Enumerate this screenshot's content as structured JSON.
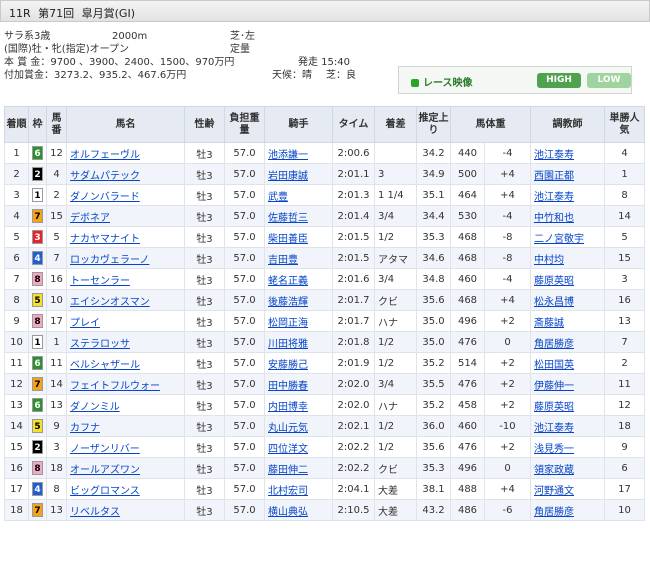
{
  "race": {
    "number": "11R",
    "edition": "第71回",
    "name": "皐月賞(GI)"
  },
  "info": {
    "class": "サラ系3歳",
    "distance": "2000m",
    "track": "芝･左",
    "conditions": "(国際)牡・牝(指定)オープン",
    "weight_rule": "定量",
    "prize": "本 賞 金：9700 、3900、2400、1500、970万円",
    "post_time": "発走 15:40",
    "bonus": "付加賞金：3273.2、935.2、467.6万円",
    "weather": "天候：晴",
    "going": "芝：良"
  },
  "video": {
    "label": "レース映像",
    "high": "HIGH",
    "low": "LOW"
  },
  "headers": [
    "着順",
    "枠",
    "馬番",
    "馬名",
    "性齢",
    "負担重量",
    "騎手",
    "タイム",
    "着差",
    "推定上り",
    "馬体重",
    "調教師",
    "単勝人気"
  ],
  "frame_colors": {
    "1": {
      "bg": "#ffffff",
      "fg": "#000000"
    },
    "2": {
      "bg": "#000000",
      "fg": "#ffffff"
    },
    "3": {
      "bg": "#e8232a",
      "fg": "#ffffff"
    },
    "4": {
      "bg": "#1f5fd0",
      "fg": "#ffffff"
    },
    "5": {
      "bg": "#f5e12b",
      "fg": "#000000"
    },
    "6": {
      "bg": "#2d8f2d",
      "fg": "#ffffff"
    },
    "7": {
      "bg": "#f5a21b",
      "fg": "#000000"
    },
    "8": {
      "bg": "#f4a6c3",
      "fg": "#000000"
    }
  },
  "rows": [
    {
      "rank": "1",
      "frame": "6",
      "num": "12",
      "horse": "オルフェーヴル",
      "sex_age": "牡3",
      "weight": "57.0",
      "jockey": "池添謙一",
      "time": "2:00.6",
      "margin": "",
      "last3f": "34.2",
      "body": "440",
      "diff": "-4",
      "trainer": "池江泰寿",
      "pop": "4"
    },
    {
      "rank": "2",
      "frame": "2",
      "num": "4",
      "horse": "サダムパテック",
      "sex_age": "牡3",
      "weight": "57.0",
      "jockey": "岩田康誠",
      "time": "2:01.1",
      "margin": "3",
      "last3f": "34.9",
      "body": "500",
      "diff": "+4",
      "trainer": "西園正都",
      "pop": "1"
    },
    {
      "rank": "3",
      "frame": "1",
      "num": "2",
      "horse": "ダノンバラード",
      "sex_age": "牡3",
      "weight": "57.0",
      "jockey": "武豊",
      "time": "2:01.3",
      "margin": "1 1/4",
      "last3f": "35.1",
      "body": "464",
      "diff": "+4",
      "trainer": "池江泰寿",
      "pop": "8"
    },
    {
      "rank": "4",
      "frame": "7",
      "num": "15",
      "horse": "デボネア",
      "sex_age": "牡3",
      "weight": "57.0",
      "jockey": "佐藤哲三",
      "time": "2:01.4",
      "margin": "3/4",
      "last3f": "34.4",
      "body": "530",
      "diff": "-4",
      "trainer": "中竹和也",
      "pop": "14"
    },
    {
      "rank": "5",
      "frame": "3",
      "num": "5",
      "horse": "ナカヤマナイト",
      "sex_age": "牡3",
      "weight": "57.0",
      "jockey": "柴田善臣",
      "time": "2:01.5",
      "margin": "1/2",
      "last3f": "35.3",
      "body": "468",
      "diff": "-8",
      "trainer": "二ノ宮敬宇",
      "pop": "5"
    },
    {
      "rank": "6",
      "frame": "4",
      "num": "7",
      "horse": "ロッカヴェラーノ",
      "sex_age": "牡3",
      "weight": "57.0",
      "jockey": "吉田豊",
      "time": "2:01.5",
      "margin": "アタマ",
      "last3f": "34.6",
      "body": "468",
      "diff": "-8",
      "trainer": "中村均",
      "pop": "15"
    },
    {
      "rank": "7",
      "frame": "8",
      "num": "16",
      "horse": "トーセンラー",
      "sex_age": "牡3",
      "weight": "57.0",
      "jockey": "蛯名正義",
      "time": "2:01.6",
      "margin": "3/4",
      "last3f": "34.8",
      "body": "460",
      "diff": "-4",
      "trainer": "藤原英昭",
      "pop": "3"
    },
    {
      "rank": "8",
      "frame": "5",
      "num": "10",
      "horse": "エイシンオスマン",
      "sex_age": "牡3",
      "weight": "57.0",
      "jockey": "後藤浩輝",
      "time": "2:01.7",
      "margin": "クビ",
      "last3f": "35.6",
      "body": "468",
      "diff": "+4",
      "trainer": "松永昌博",
      "pop": "16"
    },
    {
      "rank": "9",
      "frame": "8",
      "num": "17",
      "horse": "プレイ",
      "sex_age": "牡3",
      "weight": "57.0",
      "jockey": "松岡正海",
      "time": "2:01.7",
      "margin": "ハナ",
      "last3f": "35.0",
      "body": "496",
      "diff": "+2",
      "trainer": "斎藤誠",
      "pop": "13"
    },
    {
      "rank": "10",
      "frame": "1",
      "num": "1",
      "horse": "ステラロッサ",
      "sex_age": "牡3",
      "weight": "57.0",
      "jockey": "川田将雅",
      "time": "2:01.8",
      "margin": "1/2",
      "last3f": "35.0",
      "body": "476",
      "diff": "0",
      "trainer": "角居勝彦",
      "pop": "7"
    },
    {
      "rank": "11",
      "frame": "6",
      "num": "11",
      "horse": "ベルシャザール",
      "sex_age": "牡3",
      "weight": "57.0",
      "jockey": "安藤勝己",
      "time": "2:01.9",
      "margin": "1/2",
      "last3f": "35.2",
      "body": "514",
      "diff": "+2",
      "trainer": "松田国英",
      "pop": "2"
    },
    {
      "rank": "12",
      "frame": "7",
      "num": "14",
      "horse": "フェイトフルウォー",
      "sex_age": "牡3",
      "weight": "57.0",
      "jockey": "田中勝春",
      "time": "2:02.0",
      "margin": "3/4",
      "last3f": "35.5",
      "body": "476",
      "diff": "+2",
      "trainer": "伊藤伸一",
      "pop": "11"
    },
    {
      "rank": "13",
      "frame": "6",
      "num": "13",
      "horse": "ダノンミル",
      "sex_age": "牡3",
      "weight": "57.0",
      "jockey": "内田博幸",
      "time": "2:02.0",
      "margin": "ハナ",
      "last3f": "35.2",
      "body": "458",
      "diff": "+2",
      "trainer": "藤原英昭",
      "pop": "12"
    },
    {
      "rank": "14",
      "frame": "5",
      "num": "9",
      "horse": "カフナ",
      "sex_age": "牡3",
      "weight": "57.0",
      "jockey": "丸山元気",
      "time": "2:02.1",
      "margin": "1/2",
      "last3f": "36.0",
      "body": "460",
      "diff": "-10",
      "trainer": "池江泰寿",
      "pop": "18"
    },
    {
      "rank": "15",
      "frame": "2",
      "num": "3",
      "horse": "ノーザンリバー",
      "sex_age": "牡3",
      "weight": "57.0",
      "jockey": "四位洋文",
      "time": "2:02.2",
      "margin": "1/2",
      "last3f": "35.6",
      "body": "476",
      "diff": "+2",
      "trainer": "浅見秀一",
      "pop": "9"
    },
    {
      "rank": "16",
      "frame": "8",
      "num": "18",
      "horse": "オールアズワン",
      "sex_age": "牡3",
      "weight": "57.0",
      "jockey": "藤田伸二",
      "time": "2:02.2",
      "margin": "クビ",
      "last3f": "35.3",
      "body": "496",
      "diff": "0",
      "trainer": "領家政蔵",
      "pop": "6"
    },
    {
      "rank": "17",
      "frame": "4",
      "num": "8",
      "horse": "ビッグロマンス",
      "sex_age": "牡3",
      "weight": "57.0",
      "jockey": "北村宏司",
      "time": "2:04.1",
      "margin": "大差",
      "last3f": "38.1",
      "body": "488",
      "diff": "+4",
      "trainer": "河野通文",
      "pop": "17"
    },
    {
      "rank": "18",
      "frame": "7",
      "num": "13",
      "horse": "リベルタス",
      "sex_age": "牡3",
      "weight": "57.0",
      "jockey": "横山典弘",
      "time": "2:10.5",
      "margin": "大差",
      "last3f": "43.2",
      "body": "486",
      "diff": "-6",
      "trainer": "角居勝彦",
      "pop": "10"
    }
  ]
}
